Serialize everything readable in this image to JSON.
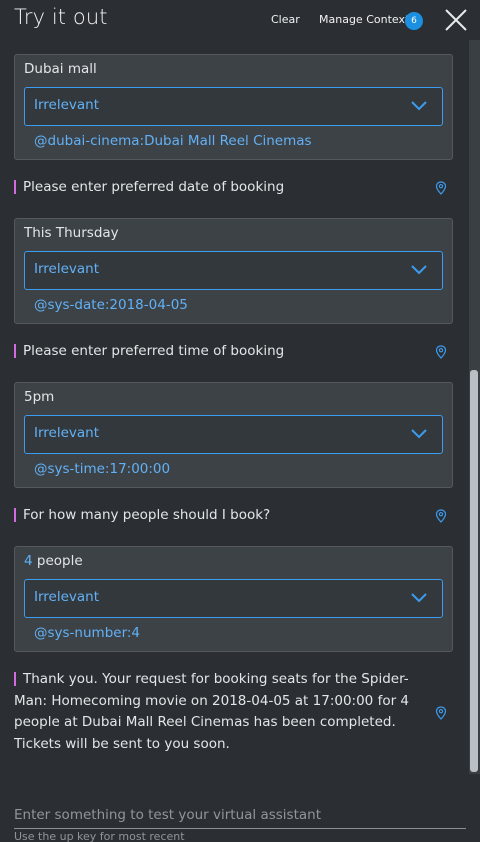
{
  "header": {
    "title": "Try it out",
    "clear_label": "Clear",
    "manage_context_label": "Manage Context",
    "context_count": "6"
  },
  "conversation": [
    {
      "user_text": "Dubai mall",
      "user_text_highlight": "",
      "user_text_rest": "Dubai mall",
      "intent": "Irrelevant",
      "entity": "@dubai-cinema:Dubai Mall Reel Cinemas"
    },
    {
      "bot_text": "Please enter preferred date of booking"
    },
    {
      "user_text_highlight": "",
      "user_text_rest": "This Thursday",
      "intent": "Irrelevant",
      "entity": "@sys-date:2018-04-05"
    },
    {
      "bot_text": "Please enter preferred time of booking"
    },
    {
      "user_text_highlight": "",
      "user_text_rest": "5pm",
      "intent": "Irrelevant",
      "entity": "@sys-time:17:00:00"
    },
    {
      "bot_text": "For how many people should I book?"
    },
    {
      "user_text_highlight": "4",
      "user_text_rest": " people",
      "intent": "Irrelevant",
      "entity": "@sys-number:4"
    },
    {
      "bot_text": "Thank you. Your request for booking seats for the Spider-Man: Homecoming movie on 2018-04-05 at 17:00:00 for 4 people at Dubai Mall Reel Cinemas has been completed. Tickets will be sent to you soon."
    }
  ],
  "input": {
    "placeholder": "Enter something to test your virtual assistant",
    "value": "",
    "hint": "Use the up key for most recent"
  },
  "icons": {
    "close": "close-icon",
    "chevron": "chevron-down-icon",
    "pin": "location-pin-icon"
  },
  "colors": {
    "background": "#2b2f33",
    "card": "#3d4246",
    "accent_blue": "#3c9cf0",
    "link_blue": "#62b1f6",
    "badge": "#1b8fe0",
    "bot_marker": "#d36ae0"
  }
}
